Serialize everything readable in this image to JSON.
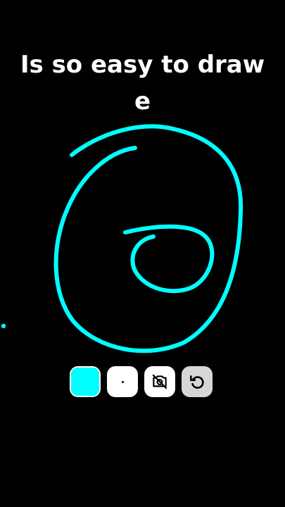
{
  "caption": {
    "line1": "Is so easy to draw",
    "line2": "e"
  },
  "colors": {
    "background": "#000000",
    "stroke": "#00ffff",
    "caption_text": "#ffffff",
    "selected_color": "#00ffff",
    "undo_button_bg": "#d6d6d6"
  },
  "toolbar": {
    "tools": [
      {
        "name": "color-swatch",
        "icon": "cyan-swatch"
      },
      {
        "name": "brush-size",
        "icon": "dot-icon"
      },
      {
        "name": "camera-off",
        "icon": "camera-off-icon"
      },
      {
        "name": "undo",
        "icon": "undo-icon"
      }
    ]
  }
}
